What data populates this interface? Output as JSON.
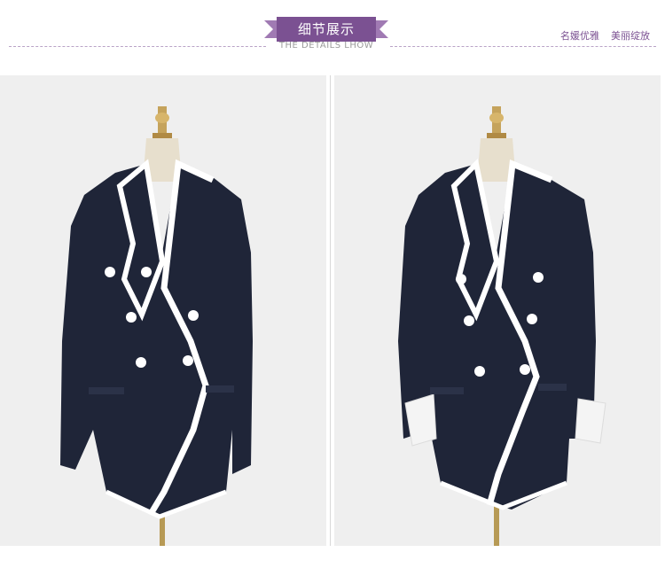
{
  "header": {
    "title": "细节展示",
    "subtitle": "THE DETAILS LHOW",
    "tagline_1": "名媛优雅",
    "tagline_2": "美丽绽放"
  },
  "photos": [
    {
      "name": "blazer-front-buttoned"
    },
    {
      "name": "blazer-front-cuffs-rolled"
    }
  ],
  "colors": {
    "accent": "#7b5192",
    "jacket": "#1f2538",
    "trim": "#ffffff",
    "background": "#efefef"
  }
}
